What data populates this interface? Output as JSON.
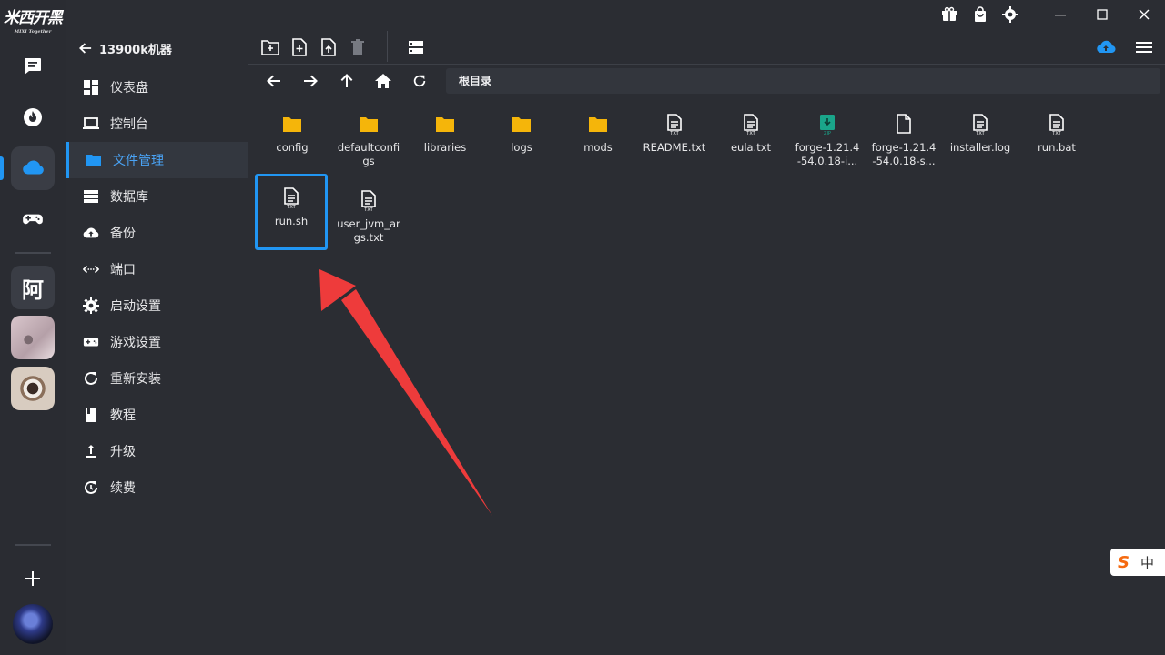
{
  "app": {
    "logo_text": "米西开黑",
    "logo_sub": "MIXI Together"
  },
  "rail": {
    "server_letter": "阿",
    "add_label": "+"
  },
  "sidebar": {
    "back_title": "13900k机器",
    "items": [
      {
        "label": "仪表盘",
        "icon": "dashboard-icon"
      },
      {
        "label": "控制台",
        "icon": "monitor-icon"
      },
      {
        "label": "文件管理",
        "icon": "folder-icon",
        "active": true
      },
      {
        "label": "数据库",
        "icon": "database-icon"
      },
      {
        "label": "备份",
        "icon": "cloud-upload-icon"
      },
      {
        "label": "端口",
        "icon": "port-icon"
      },
      {
        "label": "启动设置",
        "icon": "gear-icon"
      },
      {
        "label": "游戏设置",
        "icon": "gamepad-icon"
      },
      {
        "label": "重新安装",
        "icon": "refresh-icon"
      },
      {
        "label": "教程",
        "icon": "book-icon"
      },
      {
        "label": "升级",
        "icon": "upgrade-icon"
      },
      {
        "label": "续费",
        "icon": "renew-icon"
      }
    ]
  },
  "main": {
    "path": "根目录",
    "files": [
      {
        "name": "config",
        "type": "folder"
      },
      {
        "name": "defaultconfigs",
        "type": "folder"
      },
      {
        "name": "libraries",
        "type": "folder"
      },
      {
        "name": "logs",
        "type": "folder"
      },
      {
        "name": "mods",
        "type": "folder"
      },
      {
        "name": "README.txt",
        "type": "txt"
      },
      {
        "name": "eula.txt",
        "type": "txt"
      },
      {
        "name": "forge-1.21.4-54.0.18-i...",
        "type": "zip"
      },
      {
        "name": "forge-1.21.4-54.0.18-s...",
        "type": "blank"
      },
      {
        "name": "installer.log",
        "type": "txt"
      },
      {
        "name": "run.bat",
        "type": "txt"
      },
      {
        "name": "run.sh",
        "type": "txt",
        "selected": true
      },
      {
        "name": "user_jvm_args.txt",
        "type": "txt"
      }
    ]
  },
  "ime": {
    "logo": "S",
    "mode": "中"
  },
  "colors": {
    "accent": "#2196f3",
    "folder": "#f5b50a",
    "arrow": "#ee3b3b",
    "zip": "#1aa58a"
  }
}
